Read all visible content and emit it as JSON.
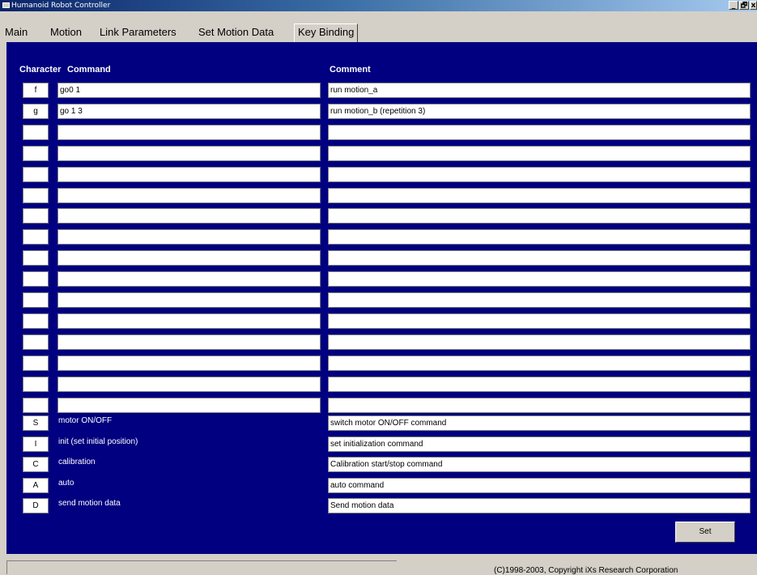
{
  "window": {
    "title": "Humanoid Robot Controller",
    "minimize_glyph": "_",
    "restore_glyph": "🗗",
    "close_glyph": "x"
  },
  "menu": {
    "tabs": [
      {
        "label": "Main"
      },
      {
        "label": "Motion"
      },
      {
        "label": "Link Parameters"
      },
      {
        "label": "Set Motion Data"
      },
      {
        "label": "Key Binding"
      }
    ],
    "active": "Key Binding"
  },
  "headers": {
    "character": "Character",
    "command": "Command",
    "comment": "Comment"
  },
  "bindings": [
    {
      "key": "f",
      "command": "go0 1",
      "comment": "run motion_a"
    },
    {
      "key": "g",
      "command": "go 1 3",
      "comment": "run motion_b (repetition 3)"
    },
    {
      "key": "",
      "command": "",
      "comment": ""
    },
    {
      "key": "",
      "command": "",
      "comment": ""
    },
    {
      "key": "",
      "command": "",
      "comment": ""
    },
    {
      "key": "",
      "command": "",
      "comment": ""
    },
    {
      "key": "",
      "command": "",
      "comment": ""
    },
    {
      "key": "",
      "command": "",
      "comment": ""
    },
    {
      "key": "",
      "command": "",
      "comment": ""
    },
    {
      "key": "",
      "command": "",
      "comment": ""
    },
    {
      "key": "",
      "command": "",
      "comment": ""
    },
    {
      "key": "",
      "command": "",
      "comment": ""
    },
    {
      "key": "",
      "command": "",
      "comment": ""
    },
    {
      "key": "",
      "command": "",
      "comment": ""
    },
    {
      "key": "",
      "command": "",
      "comment": ""
    },
    {
      "key": "",
      "command": "",
      "comment": ""
    }
  ],
  "system_bindings": [
    {
      "key": "S",
      "label": "motor ON/OFF",
      "comment": "switch motor ON/OFF command"
    },
    {
      "key": "I",
      "label": "init (set initial position)",
      "comment": "set initialization command"
    },
    {
      "key": "C",
      "label": "calibration",
      "comment": "Calibration start/stop command"
    },
    {
      "key": "A",
      "label": "auto",
      "comment": "auto command"
    },
    {
      "key": "D",
      "label": "send motion data",
      "comment": "Send motion data"
    }
  ],
  "set_button": "Set",
  "status": {
    "copyright": "(C)1998-2003, Copyright iXs Research Corporation"
  },
  "colors": {
    "panel": "#000080",
    "chrome": "#d4d0c8",
    "titlebar_start": "#0a246a",
    "titlebar_end": "#a6caf0"
  }
}
